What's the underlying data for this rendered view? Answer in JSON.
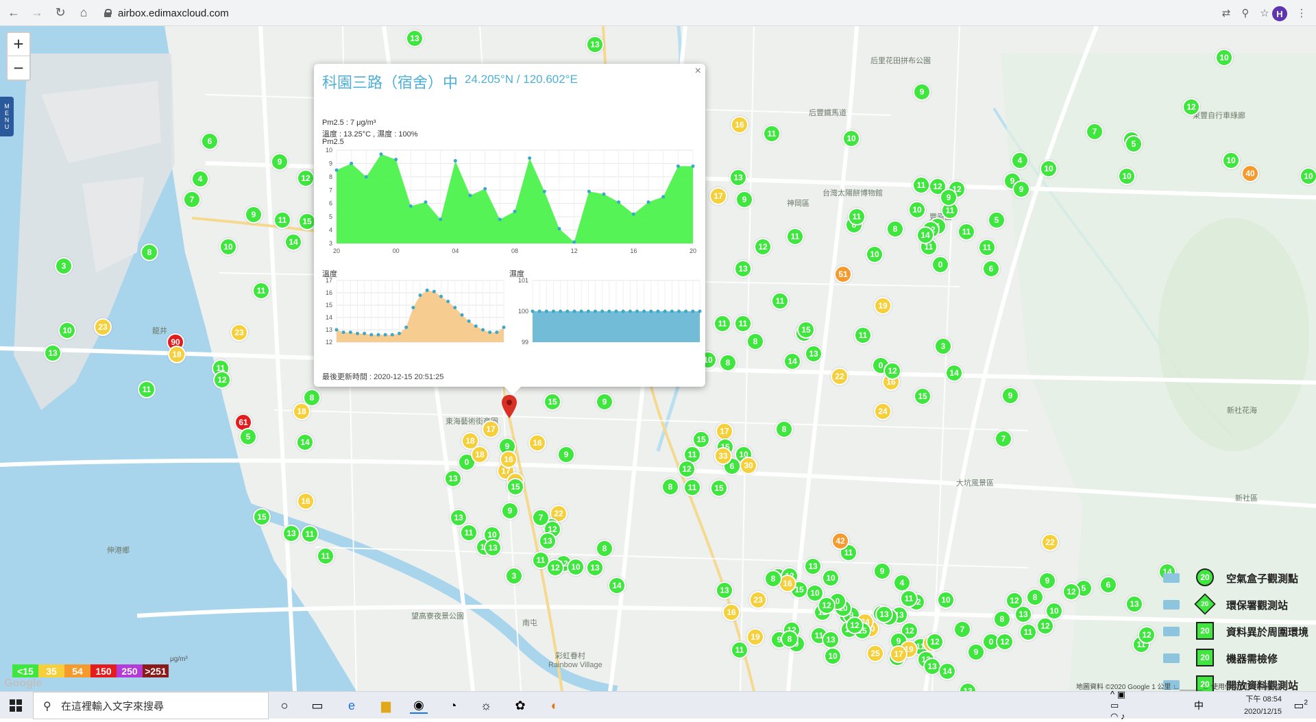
{
  "browser": {
    "url": "airbox.edimaxcloud.com",
    "profile_initial": "H",
    "translate_icon": "translate-icon",
    "zoom_icon": "zoom-icon",
    "star_icon": "star-icon"
  },
  "map": {
    "zoom_in_label": "+",
    "zoom_out_label": "−",
    "menu_label": [
      "M",
      "E",
      "N",
      "U"
    ],
    "google_label": "Google",
    "attribution": "地圖資料 ©2020 Google    1 公里 ∟______∟    使用條款    回報地圖錯誤",
    "place_labels": [
      {
        "text": "后里花田拼布公園"
      },
      {
        "text": "后豐鐵馬道"
      },
      {
        "text": "東豐自行車綠廊"
      },
      {
        "text": "神岡區"
      },
      {
        "text": "台灣太陽餅博物館"
      },
      {
        "text": "豐原區"
      },
      {
        "text": "新社花海"
      },
      {
        "text": "新社區"
      },
      {
        "text": "東海藝術街商圈"
      },
      {
        "text": "龍井"
      },
      {
        "text": "伸港鄉"
      },
      {
        "text": "大坑風景區"
      },
      {
        "text": "彩虹眷村"
      },
      {
        "text": "Rainbow Village"
      },
      {
        "text": "南屯"
      },
      {
        "text": "望高寮夜景公園"
      },
      {
        "text": "都會"
      }
    ],
    "markers": [
      {
        "v": "13",
        "c": "g"
      },
      {
        "v": "13",
        "c": "g"
      },
      {
        "v": "6",
        "c": "g"
      },
      {
        "v": "4",
        "c": "g"
      },
      {
        "v": "7",
        "c": "g"
      },
      {
        "v": "9",
        "c": "g"
      },
      {
        "v": "12",
        "c": "g"
      },
      {
        "v": "9",
        "c": "g"
      },
      {
        "v": "11",
        "c": "g"
      },
      {
        "v": "15",
        "c": "g"
      },
      {
        "v": "8",
        "c": "g"
      },
      {
        "v": "10",
        "c": "g"
      },
      {
        "v": "14",
        "c": "g"
      },
      {
        "v": "3",
        "c": "g"
      },
      {
        "v": "11",
        "c": "g"
      },
      {
        "v": "10",
        "c": "g"
      },
      {
        "v": "23",
        "c": "y"
      },
      {
        "v": "23",
        "c": "y"
      },
      {
        "v": "90",
        "c": "r"
      },
      {
        "v": "18",
        "c": "y"
      },
      {
        "v": "13",
        "c": "g"
      },
      {
        "v": "11",
        "c": "g"
      },
      {
        "v": "12",
        "c": "g"
      },
      {
        "v": "11",
        "c": "g"
      },
      {
        "v": "8",
        "c": "g"
      },
      {
        "v": "61",
        "c": "r"
      },
      {
        "v": "5",
        "c": "g"
      },
      {
        "v": "18",
        "c": "y"
      },
      {
        "v": "14",
        "c": "g"
      },
      {
        "v": "16",
        "c": "y"
      },
      {
        "v": "15",
        "c": "g"
      },
      {
        "v": "13",
        "c": "g"
      },
      {
        "v": "11",
        "c": "g"
      },
      {
        "v": "11",
        "c": "g"
      },
      {
        "v": "10",
        "c": "g"
      },
      {
        "v": "12",
        "c": "g"
      },
      {
        "v": "7",
        "c": "g"
      },
      {
        "v": "9",
        "c": "g"
      },
      {
        "v": "16",
        "c": "y"
      },
      {
        "v": "11",
        "c": "g"
      },
      {
        "v": "10",
        "c": "g"
      },
      {
        "v": "12",
        "c": "g"
      },
      {
        "v": "4",
        "c": "g"
      },
      {
        "v": "10",
        "c": "g"
      },
      {
        "v": "17",
        "c": "y"
      },
      {
        "v": "9",
        "c": "g"
      },
      {
        "v": "10",
        "c": "g"
      },
      {
        "v": "40",
        "c": "o"
      },
      {
        "v": "10",
        "c": "g"
      },
      {
        "v": "10",
        "c": "g"
      },
      {
        "v": "5",
        "c": "g"
      },
      {
        "v": "13",
        "c": "g"
      },
      {
        "v": "9",
        "c": "g"
      },
      {
        "v": "9",
        "c": "g"
      },
      {
        "v": "11",
        "c": "g"
      },
      {
        "v": "12",
        "c": "g"
      },
      {
        "v": "12",
        "c": "g"
      },
      {
        "v": "10",
        "c": "g"
      },
      {
        "v": "11",
        "c": "g"
      },
      {
        "v": "9",
        "c": "g"
      },
      {
        "v": "6",
        "c": "g"
      },
      {
        "v": "8",
        "c": "g"
      },
      {
        "v": "12",
        "c": "g"
      },
      {
        "v": "5",
        "c": "g"
      },
      {
        "v": "11",
        "c": "g"
      },
      {
        "v": "14",
        "c": "g"
      },
      {
        "v": "11",
        "c": "g"
      },
      {
        "v": "6",
        "c": "g"
      },
      {
        "v": "10",
        "c": "g"
      },
      {
        "v": "0",
        "c": "g"
      },
      {
        "v": "6",
        "c": "g"
      },
      {
        "v": "11",
        "c": "g"
      },
      {
        "v": "13",
        "c": "g"
      },
      {
        "v": "12",
        "c": "g"
      },
      {
        "v": "11",
        "c": "g"
      },
      {
        "v": "51",
        "c": "o"
      },
      {
        "v": "11",
        "c": "g"
      },
      {
        "v": "11",
        "c": "g"
      },
      {
        "v": "19",
        "c": "y"
      },
      {
        "v": "14",
        "c": "g"
      },
      {
        "v": "11",
        "c": "g"
      },
      {
        "v": "0",
        "c": "g"
      },
      {
        "v": "3",
        "c": "g"
      },
      {
        "v": "14",
        "c": "g"
      },
      {
        "v": "16",
        "c": "y"
      },
      {
        "v": "15",
        "c": "g"
      },
      {
        "v": "12",
        "c": "g"
      },
      {
        "v": "9",
        "c": "g"
      },
      {
        "v": "7",
        "c": "g"
      },
      {
        "v": "24",
        "c": "y"
      },
      {
        "v": "8",
        "c": "g"
      },
      {
        "v": "11",
        "c": "g"
      },
      {
        "v": "11",
        "c": "g"
      },
      {
        "v": "10",
        "c": "g"
      },
      {
        "v": "13",
        "c": "g"
      },
      {
        "v": "14",
        "c": "g"
      },
      {
        "v": "15",
        "c": "g"
      },
      {
        "v": "13",
        "c": "g"
      },
      {
        "v": "8",
        "c": "g"
      },
      {
        "v": "22",
        "c": "y"
      },
      {
        "v": "17",
        "c": "y"
      },
      {
        "v": "15",
        "c": "g"
      },
      {
        "v": "6",
        "c": "g"
      },
      {
        "v": "8",
        "c": "g"
      },
      {
        "v": "10",
        "c": "g"
      },
      {
        "v": "15",
        "c": "g"
      },
      {
        "v": "15",
        "c": "g"
      },
      {
        "v": "11",
        "c": "g"
      },
      {
        "v": "12",
        "c": "g"
      },
      {
        "v": "11",
        "c": "g"
      },
      {
        "v": "9",
        "c": "g"
      },
      {
        "v": "15",
        "c": "g"
      },
      {
        "v": "17",
        "c": "y"
      },
      {
        "v": "0",
        "c": "g"
      },
      {
        "v": "16",
        "c": "y"
      },
      {
        "v": "18",
        "c": "y"
      },
      {
        "v": "18",
        "c": "y"
      },
      {
        "v": "13",
        "c": "g"
      },
      {
        "v": "17",
        "c": "y"
      },
      {
        "v": "9",
        "c": "g"
      },
      {
        "v": "9",
        "c": "g"
      },
      {
        "v": "16",
        "c": "y"
      },
      {
        "v": "19",
        "c": "y"
      },
      {
        "v": "15",
        "c": "g"
      },
      {
        "v": "13",
        "c": "g"
      },
      {
        "v": "11",
        "c": "g"
      },
      {
        "v": "11",
        "c": "g"
      },
      {
        "v": "10",
        "c": "g"
      },
      {
        "v": "13",
        "c": "g"
      },
      {
        "v": "3",
        "c": "g"
      },
      {
        "v": "22",
        "c": "y"
      },
      {
        "v": "9",
        "c": "g"
      },
      {
        "v": "10",
        "c": "g"
      },
      {
        "v": "12",
        "c": "g"
      },
      {
        "v": "13",
        "c": "g"
      },
      {
        "v": "7",
        "c": "g"
      },
      {
        "v": "11",
        "c": "g"
      },
      {
        "v": "12",
        "c": "g"
      },
      {
        "v": "12",
        "c": "g"
      },
      {
        "v": "10",
        "c": "g"
      },
      {
        "v": "33",
        "c": "y"
      },
      {
        "v": "30",
        "c": "y"
      },
      {
        "v": "8",
        "c": "g"
      },
      {
        "v": "13",
        "c": "g"
      },
      {
        "v": "8",
        "c": "g"
      },
      {
        "v": "14",
        "c": "g"
      },
      {
        "v": "15",
        "c": "g"
      },
      {
        "v": "12",
        "c": "g"
      },
      {
        "v": "13",
        "c": "g"
      },
      {
        "v": "10",
        "c": "g"
      },
      {
        "v": "12",
        "c": "g"
      },
      {
        "v": "10",
        "c": "g"
      },
      {
        "v": "11",
        "c": "g"
      },
      {
        "v": "13",
        "c": "g"
      },
      {
        "v": "12",
        "c": "g"
      },
      {
        "v": "6",
        "c": "g"
      },
      {
        "v": "9",
        "c": "g"
      },
      {
        "v": "25",
        "c": "y"
      },
      {
        "v": "20",
        "c": "y"
      },
      {
        "v": "11",
        "c": "g"
      },
      {
        "v": "12",
        "c": "g"
      },
      {
        "v": "24",
        "c": "y"
      },
      {
        "v": "10",
        "c": "g"
      },
      {
        "v": "4",
        "c": "g"
      },
      {
        "v": "9",
        "c": "g"
      },
      {
        "v": "0",
        "c": "g"
      },
      {
        "v": "10",
        "c": "g"
      },
      {
        "v": "4",
        "c": "g"
      },
      {
        "v": "9",
        "c": "g"
      },
      {
        "v": "11",
        "c": "g"
      },
      {
        "v": "42",
        "c": "o"
      },
      {
        "v": "15",
        "c": "g"
      },
      {
        "v": "16",
        "c": "y"
      },
      {
        "v": "8",
        "c": "g"
      },
      {
        "v": "13",
        "c": "g"
      },
      {
        "v": "23",
        "c": "y"
      },
      {
        "v": "16",
        "c": "y"
      },
      {
        "v": "19",
        "c": "y"
      },
      {
        "v": "11",
        "c": "g"
      },
      {
        "v": "9",
        "c": "g"
      },
      {
        "v": "11",
        "c": "g"
      },
      {
        "v": "12",
        "c": "g"
      },
      {
        "v": "14",
        "c": "g"
      },
      {
        "v": "15",
        "c": "g"
      },
      {
        "v": "10",
        "c": "g"
      },
      {
        "v": "12",
        "c": "g"
      },
      {
        "v": "9",
        "c": "g"
      },
      {
        "v": "13",
        "c": "g"
      },
      {
        "v": "8",
        "c": "g"
      },
      {
        "v": "12",
        "c": "g"
      },
      {
        "v": "11",
        "c": "g"
      },
      {
        "v": "10",
        "c": "g"
      },
      {
        "v": "13",
        "c": "g"
      },
      {
        "v": "26",
        "c": "y"
      },
      {
        "v": "7",
        "c": "g"
      },
      {
        "v": "12",
        "c": "g"
      },
      {
        "v": "13",
        "c": "g"
      },
      {
        "v": "9",
        "c": "g"
      },
      {
        "v": "14",
        "c": "g"
      },
      {
        "v": "13",
        "c": "g"
      },
      {
        "v": "12",
        "c": "g"
      },
      {
        "v": "19",
        "c": "y"
      },
      {
        "v": "17",
        "c": "y"
      },
      {
        "v": "0",
        "c": "g"
      },
      {
        "v": "12",
        "c": "g"
      },
      {
        "v": "8",
        "c": "g"
      },
      {
        "v": "9",
        "c": "g"
      },
      {
        "v": "5",
        "c": "g"
      },
      {
        "v": "6",
        "c": "g"
      },
      {
        "v": "13",
        "c": "g"
      },
      {
        "v": "11",
        "c": "g"
      },
      {
        "v": "12",
        "c": "g"
      },
      {
        "v": "14",
        "c": "g"
      },
      {
        "v": "12",
        "c": "g"
      },
      {
        "v": "11",
        "c": "g"
      },
      {
        "v": "13",
        "c": "g"
      },
      {
        "v": "12",
        "c": "g"
      },
      {
        "v": "12",
        "c": "g"
      },
      {
        "v": "10",
        "c": "g"
      },
      {
        "v": "8",
        "c": "g"
      },
      {
        "v": "22",
        "c": "y"
      }
    ],
    "selected_pin_icon": "map-pin-icon"
  },
  "popup": {
    "title": "科園三路（宿舍）中",
    "coords": "24.205°N / 120.602°E",
    "pm25_line": "Pm2.5 : 7 μg/m³",
    "temp_hum_line": "溫度 : 13.25°C , 濕度 : 100%",
    "pm25_chart_label": "Pm2.5",
    "temp_chart_label": "溫度",
    "hum_chart_label": "濕度",
    "update_line": "最後更新時間 : 2020-12-15 20:51:25",
    "close_label": "×"
  },
  "chart_data": [
    {
      "type": "area",
      "title": "Pm2.5",
      "x": [
        "20",
        "21",
        "22",
        "23",
        "00",
        "01",
        "02",
        "03",
        "04",
        "05",
        "06",
        "07",
        "08",
        "09",
        "10",
        "11",
        "12",
        "13",
        "14",
        "15",
        "16",
        "17",
        "18",
        "19",
        "20"
      ],
      "x_tick_labels": [
        "20",
        "00",
        "04",
        "08",
        "12",
        "16",
        "20"
      ],
      "values": [
        8.5,
        9,
        8,
        9.7,
        9.3,
        5.8,
        6.1,
        4.8,
        9.2,
        6.6,
        7.1,
        4.8,
        5.4,
        9.4,
        6.9,
        4.1,
        3.1,
        6.9,
        6.7,
        6.1,
        5.2,
        6.1,
        6.5,
        8.8,
        8.8
      ],
      "ylim": [
        3,
        10
      ],
      "yticks": [
        3,
        4,
        5,
        6,
        7,
        8,
        9,
        10
      ],
      "color": "#4cf24c"
    },
    {
      "type": "area",
      "title": "溫度",
      "x": [
        "20:00",
        "20:30",
        "21:00",
        "21:30",
        "22:00",
        "22:30",
        "23:00",
        "23:30",
        "00:00",
        "00:30",
        "01:00",
        "01:30",
        "02:00",
        "02:30",
        "03:00",
        "03:30",
        "04:00",
        "04:30",
        "05:00",
        "05:30",
        "06:00",
        "06:30",
        "07:00",
        "07:30",
        "08:00"
      ],
      "values": [
        13,
        12.8,
        12.8,
        12.7,
        12.7,
        12.6,
        12.6,
        12.6,
        12.6,
        12.7,
        13.2,
        14.8,
        15.8,
        16.2,
        16.1,
        15.7,
        15.3,
        14.8,
        14.2,
        13.7,
        13.3,
        13,
        12.8,
        12.8,
        13.2
      ],
      "ylim": [
        12,
        17
      ],
      "yticks": [
        12,
        13,
        14,
        15,
        16,
        17
      ],
      "color": "#f7c98b"
    },
    {
      "type": "area",
      "title": "濕度",
      "values": [
        100,
        100,
        100,
        100,
        100,
        100,
        100,
        100,
        100,
        100,
        100,
        100,
        100,
        100,
        100,
        100,
        100,
        100,
        100,
        100,
        100,
        100,
        100,
        100,
        100
      ],
      "ylim": [
        99,
        101
      ],
      "yticks": [
        99,
        100,
        101
      ],
      "color": "#6ab8d6"
    }
  ],
  "aq_legend": [
    {
      "label": "<15",
      "color": "#3ee63e"
    },
    {
      "label": "35",
      "color": "#f5d03b"
    },
    {
      "label": "54",
      "color": "#f59a2c"
    },
    {
      "label": "150",
      "color": "#e31d1d"
    },
    {
      "label": "250",
      "color": "#b43bd6"
    },
    {
      "label": ">251",
      "color": "#8b1a1a"
    }
  ],
  "aq_unit": "μg/m³",
  "type_legend": [
    {
      "label": "空氣盒子觀測點",
      "badge": "20",
      "icon": "airbox-icon",
      "shape": "circle"
    },
    {
      "label": "環保署觀測站",
      "badge": "20",
      "icon": "government-building-icon",
      "shape": "diamond"
    },
    {
      "label": "資料異於周圍環境",
      "badge": "20",
      "icon": "house-icon",
      "shape": "hexagon"
    },
    {
      "label": "機器需檢修",
      "badge": "20",
      "icon": "cone-icon",
      "shape": "triangle"
    },
    {
      "label": "開放資料觀測站",
      "badge": "20",
      "icon": "open-data-icon",
      "shape": "square"
    }
  ],
  "taskbar": {
    "search_placeholder": "在這裡輸入文字來搜尋",
    "time": "下午 08:54",
    "date": "2020/12/15",
    "ime": "中",
    "notification_count": "2"
  }
}
